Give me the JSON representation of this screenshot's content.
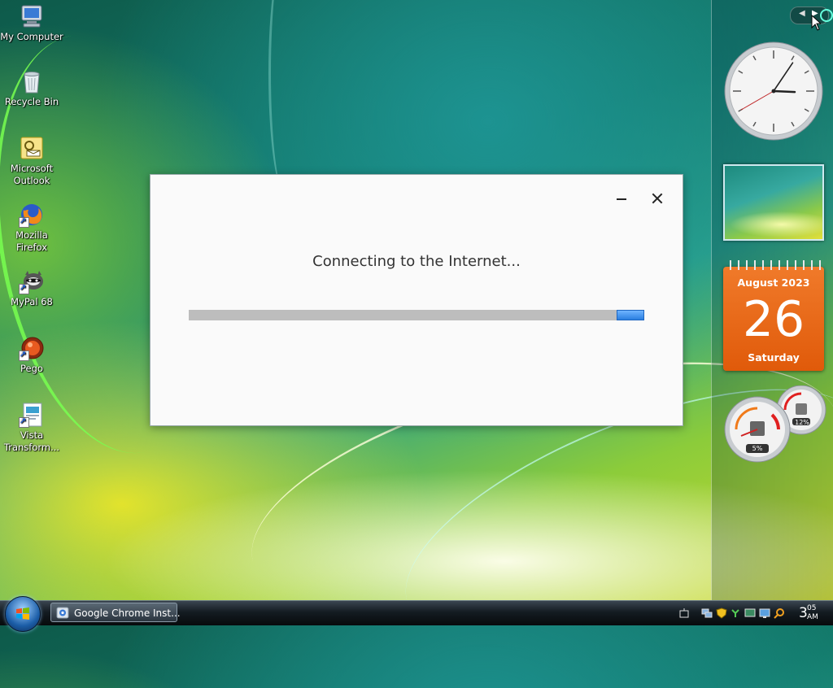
{
  "desktop": {
    "icons": [
      {
        "label": "My Computer",
        "icon": "computer-icon"
      },
      {
        "label": "Recycle Bin",
        "icon": "recycle-bin-icon"
      },
      {
        "label": "Microsoft\nOutlook",
        "icon": "outlook-icon"
      },
      {
        "label": "Mozilla\nFirefox",
        "icon": "firefox-icon"
      },
      {
        "label": "MyPal 68",
        "icon": "mypal-icon"
      },
      {
        "label": "Pego",
        "icon": "pego-icon"
      },
      {
        "label": "Vista\nTransform...",
        "icon": "vista-transform-icon"
      }
    ]
  },
  "dialog": {
    "status_text": "Connecting to the Internet...",
    "progress_style": "marquee",
    "progress_color": "#2a7fe0"
  },
  "sidebar": {
    "calendar": {
      "month_year": "August 2023",
      "day": "26",
      "weekday": "Saturday"
    },
    "clock": {
      "hour": 3,
      "minute": 5,
      "second": 40
    },
    "cpu_meter": {
      "cpu_percent": "5%",
      "memory_percent": "12%"
    }
  },
  "taskbar": {
    "start_icon": "windows-flag-icon",
    "tasks": [
      {
        "label": "Google Chrome Inst...",
        "icon": "chrome-installer-icon"
      }
    ],
    "tray_icons": [
      "keyboard-icon",
      "network-icon",
      "security-shield-icon",
      "gadget-icon",
      "monitor-icon",
      "display-icon",
      "search-icon"
    ],
    "clock": {
      "hour": "3",
      "minute": "05",
      "ampm": "AM"
    }
  },
  "colors": {
    "accent": "#2a7fe0",
    "calendar": "#e8641a"
  }
}
